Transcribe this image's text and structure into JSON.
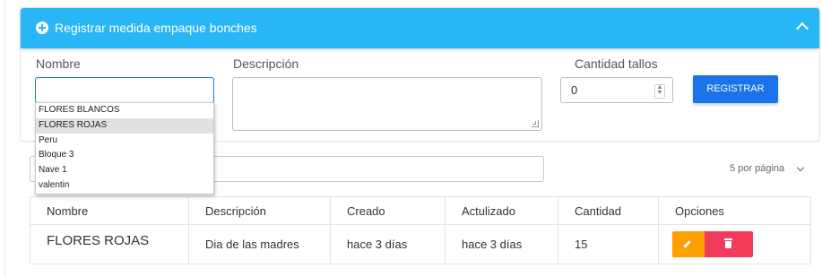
{
  "card": {
    "header_title": "Registrar medida empaque bonches"
  },
  "form": {
    "nombre_label": "Nombre",
    "nombre_value": "",
    "descripcion_label": "Descripción",
    "descripcion_value": "",
    "cantidad_label": "Cantidad tallos",
    "cantidad_value": "0",
    "register_button": "REGISTRAR"
  },
  "autocomplete": {
    "options": [
      "FLORES BLANCOS",
      "FLORES ROJAS",
      "Peru",
      "Bloque 3",
      "Nave 1",
      "valentin"
    ],
    "highlighted_index": 1
  },
  "list": {
    "search_value": "",
    "per_page": "5 por página",
    "columns": [
      "Nombre",
      "Descripción",
      "Creado",
      "Actulizado",
      "Cantidad",
      "Opciones"
    ],
    "rows": [
      {
        "nombre": "FLORES ROJAS",
        "descripcion": "Dia de las madres",
        "creado": "hace 3 días",
        "actualizado": "hace 3 días",
        "cantidad": "15"
      }
    ]
  },
  "colors": {
    "header": "#29b6f6",
    "primary": "#1a73e8",
    "edit": "#ffa000",
    "delete": "#f23a5a"
  },
  "icons": {
    "header": "plus-circle-icon",
    "collapse": "chevron-up-icon",
    "edit": "pencil-icon",
    "delete": "trash-icon"
  }
}
